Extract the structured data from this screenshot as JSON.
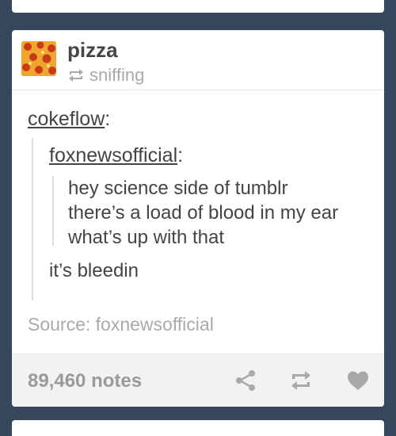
{
  "post": {
    "blog_name": "pizza",
    "reblogged_from": "sniffing",
    "trail": [
      {
        "user": "cokeflow",
        "separator": ":"
      },
      {
        "user": "foxnewsofficial",
        "separator": ":"
      }
    ],
    "original_lines": [
      "hey science side of tumblr",
      "there’s a load of blood in my ear",
      "what’s up with that"
    ],
    "reply": "it’s bleedin",
    "source_text": "Source: foxnewsofficial",
    "notes": "89,460 notes"
  },
  "icons": {
    "avatar": "pizza-avatar",
    "reblog_small": "reblog-icon",
    "share": "share-icon",
    "reblog": "reblog-icon",
    "like": "heart-icon"
  },
  "colors": {
    "background": "#36465d",
    "card": "#ffffff",
    "footer": "#f2f2f2",
    "text": "#444444",
    "muted": "#a9a9a9"
  }
}
